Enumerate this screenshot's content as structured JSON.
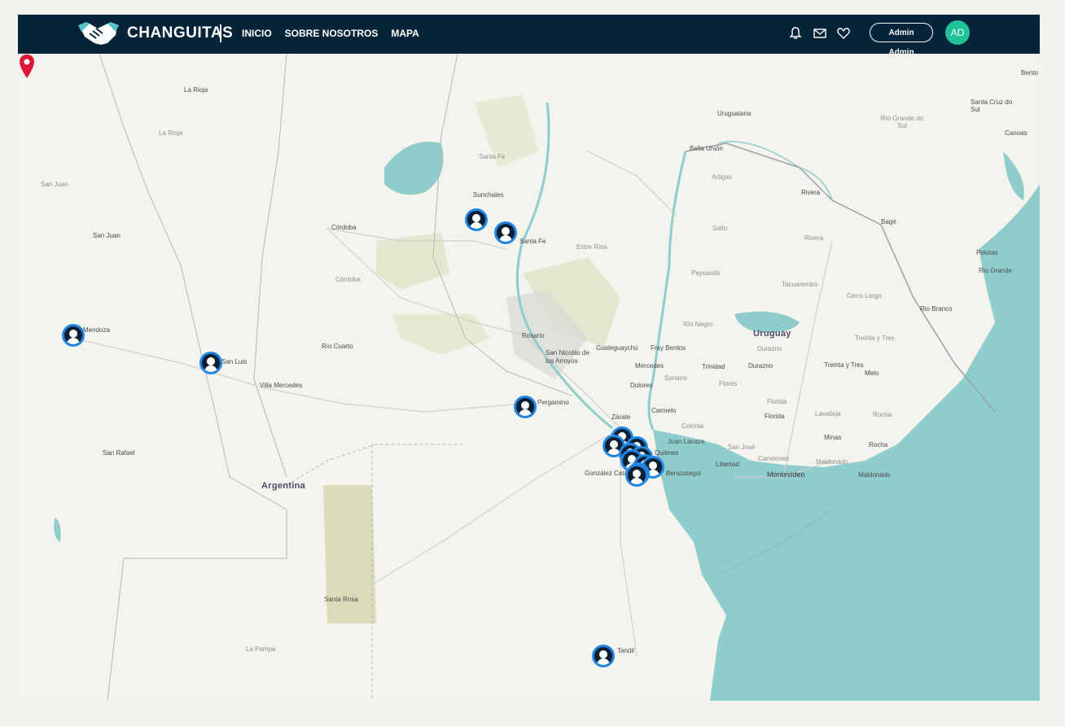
{
  "header": {
    "brand": "CHANGUITAS",
    "nav": [
      "INICIO",
      "SOBRE NOSOTROS",
      "MAPA"
    ],
    "user_button": "Admin Admin",
    "avatar_initials": "AD",
    "icons": [
      "bell-icon",
      "mail-icon",
      "heart-icon"
    ]
  },
  "map": {
    "country_labels": [
      "Argentina",
      "Uruguay"
    ],
    "region_labels": [
      "La Rioja",
      "San Juan",
      "Córdoba",
      "Santa Fe",
      "Entre Ríos",
      "Artigas",
      "Salto",
      "Paysandú",
      "Río Negro",
      "Soriano",
      "Flores",
      "Florida",
      "Durazno",
      "Tacuarembó",
      "Rivera",
      "Cerro Largo",
      "Treinta y Tres",
      "Lavalleja",
      "Rocha",
      "Maldonado",
      "Canelones",
      "San José",
      "Colonia",
      "Río Grande do Sul",
      "La Pampa"
    ],
    "city_labels": [
      "La Rioja",
      "San Juan",
      "Córdoba",
      "Sunchales",
      "Santa Fe",
      "Rosario",
      "San Nicolás de los Arroyos",
      "Gualeguaychú",
      "Fray Bentos",
      "Mercedes",
      "Dolores",
      "Carmelo",
      "Zárate",
      "Juan Lacaze",
      "Libertad",
      "Montevideo",
      "Maldonado",
      "Minas",
      "Rocha",
      "Florida",
      "Durazno",
      "Trinidad",
      "Treinta y Tres",
      "Melo",
      "Mendoza",
      "San Luis",
      "Villa Mercedes",
      "Río Cuarto",
      "San Rafael",
      "Santa Rosa",
      "González Catán",
      "Quilmes",
      "Berazategui",
      "Pergamino",
      "Uruguaiana",
      "Bella Unión",
      "Rivera",
      "Bagé",
      "Pelotas",
      "Rio Grande",
      "Rio Branco",
      "Santa Cruz do Sul",
      "Canoas",
      "Bento",
      "Tandil"
    ],
    "markers": 16,
    "selected_pin": "location-pin"
  }
}
